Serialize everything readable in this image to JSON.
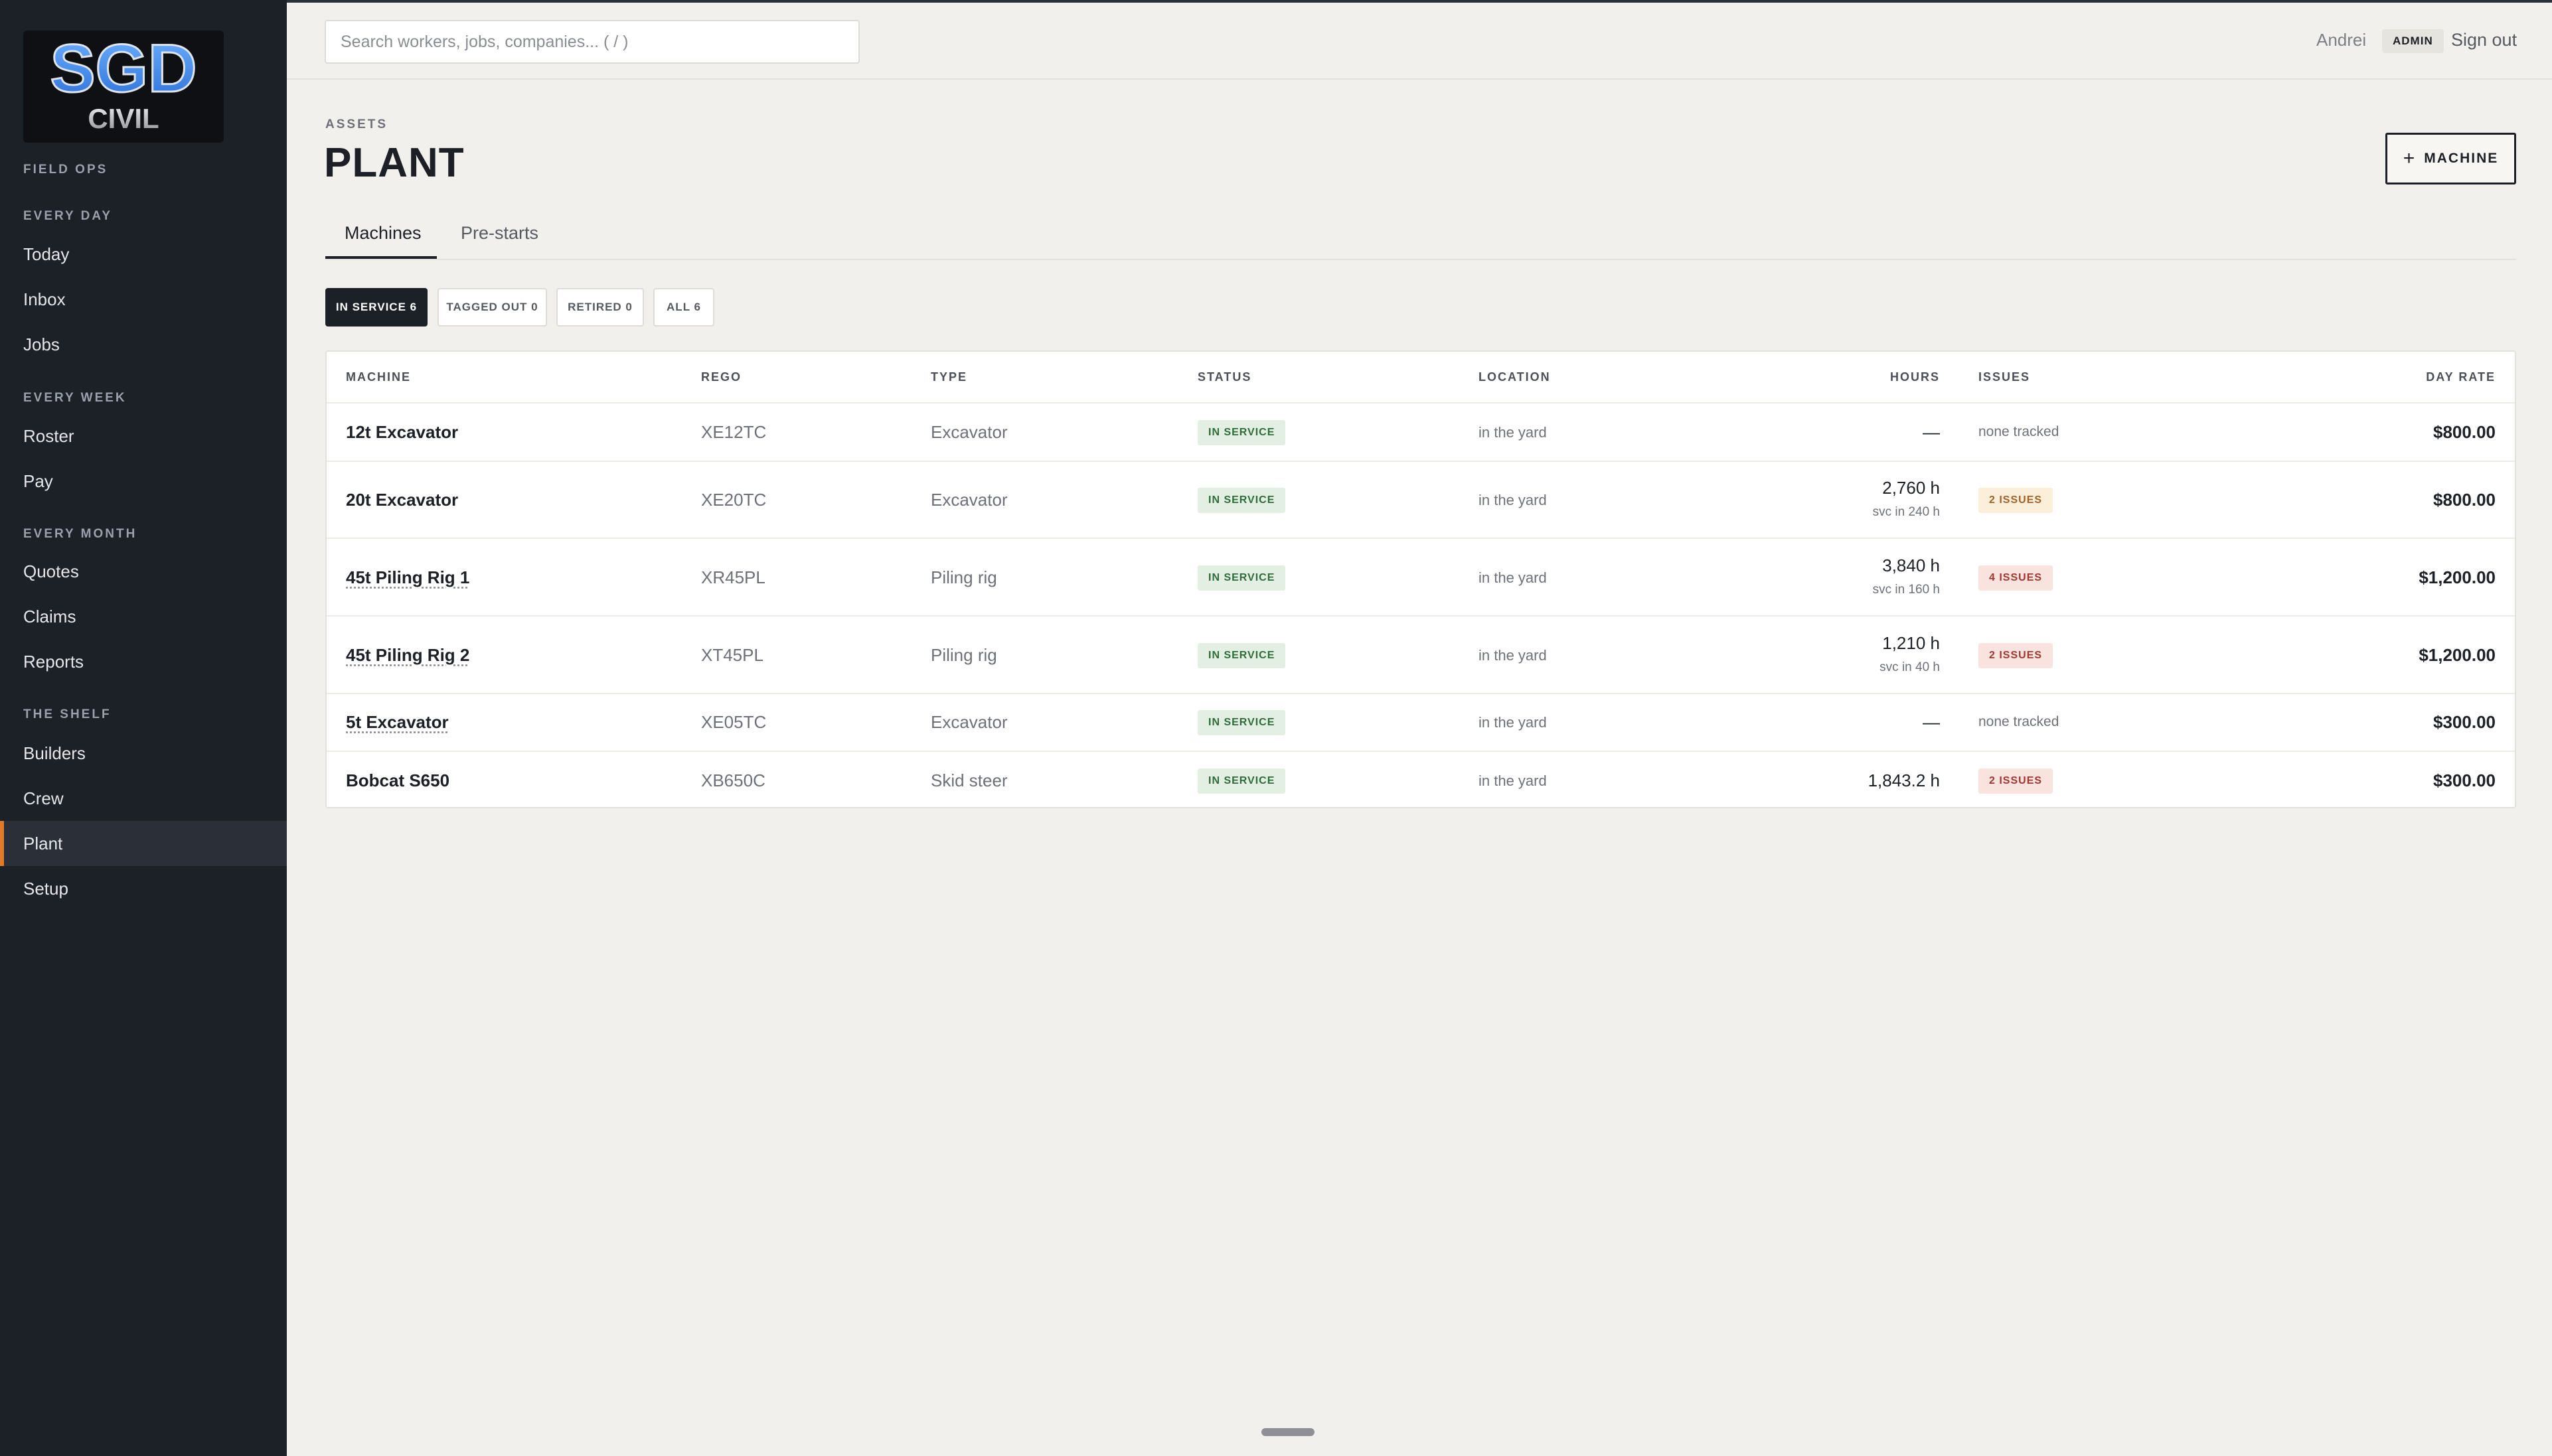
{
  "search": {
    "placeholder": "Search workers, jobs, companies... ( / )"
  },
  "user": {
    "name": "Andrei",
    "role": "ADMIN",
    "signout_label": "Sign out"
  },
  "logo": {
    "line1": "SGD",
    "line2": "CIVIL"
  },
  "sidebar": {
    "brand_section": "FIELD OPS",
    "groups": [
      {
        "title": "EVERY DAY",
        "items": [
          "Today",
          "Inbox",
          "Jobs"
        ]
      },
      {
        "title": "EVERY WEEK",
        "items": [
          "Roster",
          "Pay"
        ]
      },
      {
        "title": "EVERY MONTH",
        "items": [
          "Quotes",
          "Claims",
          "Reports"
        ]
      },
      {
        "title": "THE SHELF",
        "items": [
          "Builders",
          "Crew",
          "Plant",
          "Setup"
        ]
      }
    ],
    "active_item": "Plant"
  },
  "header": {
    "eyebrow": "ASSETS",
    "title": "PLANT",
    "add_button_label": "MACHINE"
  },
  "tabs": [
    "Machines",
    "Pre-starts"
  ],
  "filters": [
    "IN SERVICE 6",
    "TAGGED OUT 0",
    "RETIRED 0",
    "ALL 6"
  ],
  "table": {
    "columns": [
      "MACHINE",
      "REGO",
      "TYPE",
      "STATUS",
      "LOCATION",
      "HOURS",
      "ISSUES",
      "DAY RATE"
    ],
    "rows": [
      {
        "name": "12t Excavator",
        "rego": "XE12TC",
        "type": "Excavator",
        "status": "IN SERVICE",
        "location": "in the yard",
        "hours": "—",
        "svc": "",
        "issues": "none tracked",
        "rate": "$800.00"
      },
      {
        "name": "20t Excavator",
        "rego": "XE20TC",
        "type": "Excavator",
        "status": "IN SERVICE",
        "location": "in the yard",
        "hours": "2,760 h",
        "svc": "svc in 240 h",
        "issues": "2 ISSUES",
        "rate": "$800.00"
      },
      {
        "name": "45t Piling Rig 1",
        "rego": "XR45PL",
        "type": "Piling rig",
        "status": "IN SERVICE",
        "location": "in the yard",
        "hours": "3,840 h",
        "svc": "svc in 160 h",
        "issues": "4 ISSUES",
        "rate": "$1,200.00"
      },
      {
        "name": "45t Piling Rig 2",
        "rego": "XT45PL",
        "type": "Piling rig",
        "status": "IN SERVICE",
        "location": "in the yard",
        "hours": "1,210 h",
        "svc": "svc in 40 h",
        "issues": "2 ISSUES",
        "rate": "$1,200.00"
      },
      {
        "name": "5t Excavator",
        "rego": "XE05TC",
        "type": "Excavator",
        "status": "IN SERVICE",
        "location": "in the yard",
        "hours": "—",
        "svc": "",
        "issues": "none tracked",
        "rate": "$300.00"
      },
      {
        "name": "Bobcat S650",
        "rego": "XB650C",
        "type": "Skid steer",
        "status": "IN SERVICE",
        "location": "in the yard",
        "hours": "1,843.2 h",
        "svc": "",
        "issues": "2 ISSUES",
        "rate": "$300.00"
      }
    ]
  },
  "colors": {
    "sidebar_bg": "#1c2027",
    "accent": "#e27a2c",
    "in_service": "#2e6b3a",
    "issue_red": "#a3362f",
    "issue_amber": "#a0612a"
  }
}
